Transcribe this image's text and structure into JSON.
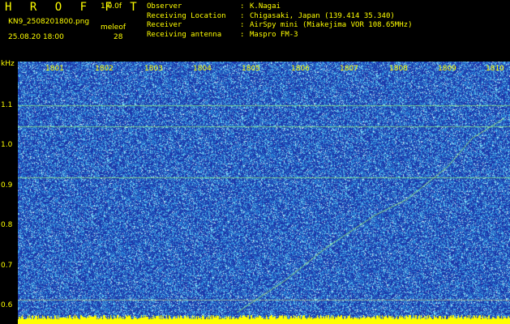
{
  "header": {
    "title": "H R O F F T",
    "version": "1.0.0f",
    "filename": "KN9_2508201800.png",
    "meleof_label": "meleof",
    "meleof_value": "28",
    "datetime": "25.08.20 18:00"
  },
  "meta": [
    {
      "label": "Observer",
      "value": "K.Nagai"
    },
    {
      "label": "Receiving Location",
      "value": "Chigasaki, Japan (139.414 35.340)"
    },
    {
      "label": "Receiver",
      "value": "AirSpy mini (Miakejima VOR 108.65MHz)"
    },
    {
      "label": "Receiving antenna",
      "value": "Maspro FM-3"
    }
  ],
  "axis": {
    "y_unit": "kHz",
    "y_ticks": [
      "1.1",
      "1.0",
      "0.9",
      "0.8",
      "0.7",
      "0.6"
    ],
    "x_ticks": [
      "1801",
      "1802",
      "1803",
      "1804",
      "1805",
      "1806",
      "1807",
      "1808",
      "1809",
      "1810"
    ]
  },
  "colors": {
    "background": "#1e3fb0",
    "noise": "#2fa0e0",
    "signal": "#a8ff60",
    "label": "#ffff00"
  }
}
